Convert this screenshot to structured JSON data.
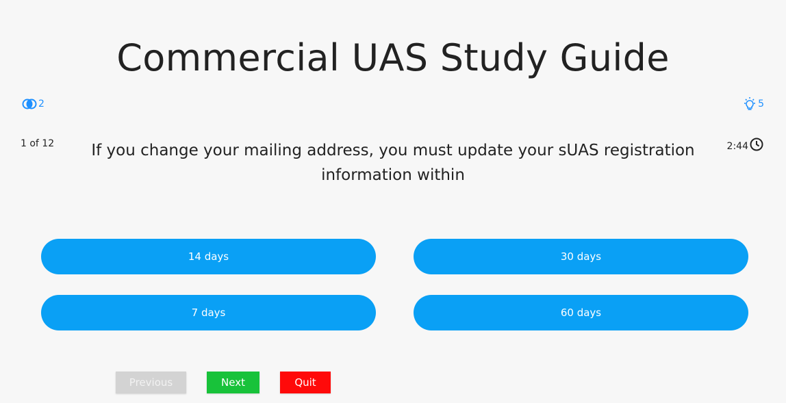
{
  "header": {
    "title": "Commercial UAS Study Guide"
  },
  "status": {
    "lifelines_count": "2",
    "lifelines_icon": "double-circle-icon",
    "hints_count": "5",
    "hints_icon": "lightbulb-icon",
    "progress": "1 of 12",
    "timer": "2:44",
    "timer_icon": "clock-icon"
  },
  "question": {
    "text": "If you change your mailing address, you must update your sUAS registration information within"
  },
  "answers": [
    {
      "label": "14 days"
    },
    {
      "label": "30 days"
    },
    {
      "label": "7 days"
    },
    {
      "label": "60 days"
    }
  ],
  "nav": {
    "previous_label": "Previous",
    "next_label": "Next",
    "quit_label": "Quit"
  },
  "colors": {
    "accent": "#0aa0f5",
    "icon_blue": "#1e90ff",
    "next_green": "#18c23a",
    "quit_red": "#ff0a0a",
    "disabled_gray": "#d3d3d3",
    "background": "#f7f7f7"
  }
}
